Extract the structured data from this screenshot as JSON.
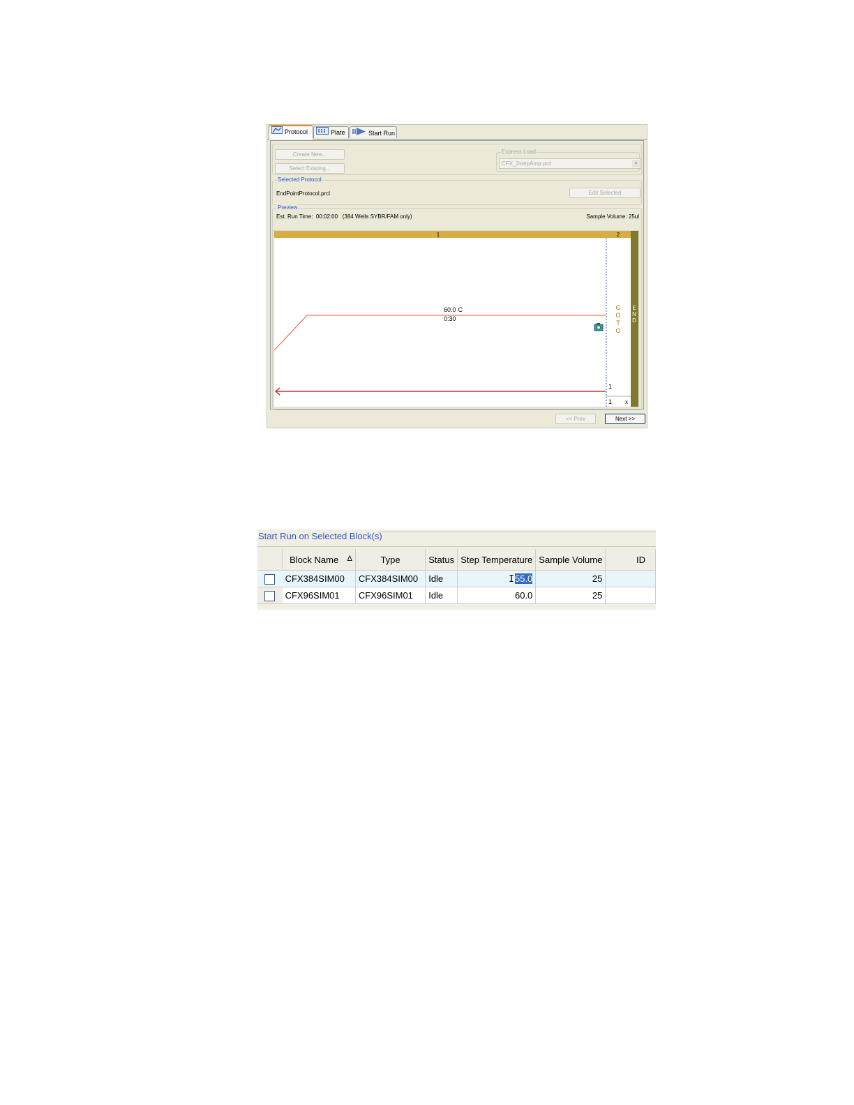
{
  "protocol_window": {
    "tabs": [
      {
        "label": "Protocol",
        "icon": "protocol-graph-icon",
        "active": true
      },
      {
        "label": "Plate",
        "icon": "plate-grid-icon",
        "active": false
      },
      {
        "label": "Start Run",
        "icon": "start-run-arrow-icon",
        "active": false
      }
    ],
    "buttons": {
      "create_new": "Create New...",
      "select_existing": "Select Existing...",
      "edit_selected": "Edit Selected"
    },
    "express_load": {
      "label": "Express Load",
      "value": "CFX_2stepAmp.prcl"
    },
    "selected_protocol": {
      "label": "Selected Protocol",
      "file": "EndPointProtocol.prcl"
    },
    "preview": {
      "label": "Preview",
      "est_run_time_label": "Est. Run Time:",
      "est_run_time_value": "00:02:00",
      "note": "(384 Wells SYBR/FAM only)",
      "sample_volume": "Sample Volume:  25ul"
    },
    "chart": {
      "step1_label": "1",
      "step2_label": "2",
      "temperature": "60.0",
      "unit": "C",
      "hold_time": "0:30",
      "goto_letters": [
        "G",
        "O",
        "T",
        "O"
      ],
      "end_letters": [
        "E",
        "N",
        "D"
      ],
      "goto_step": "1",
      "goto_cycles": "1",
      "cycles_suffix": "x"
    },
    "nav": {
      "prev": "<< Prev",
      "next": "Next >>"
    },
    "colors": {
      "step_band": "#d9ad45",
      "end_band": "#7d7a2b",
      "ramp_line": "#e8593f",
      "loop_arrow": "#c0392b",
      "goto_text": "#a27a1a"
    }
  },
  "block_table": {
    "title": "Start Run on Selected Block(s)",
    "columns": [
      "Block Name",
      "Type",
      "Status",
      "Step Temperature",
      "Sample Volume",
      "ID"
    ],
    "sort_indicator": "Δ",
    "rows": [
      {
        "block_name": "CFX384SIM00",
        "type": "CFX384SIM00",
        "status": "Idle",
        "step_temperature": "55.0",
        "sample_volume": "25",
        "id": "",
        "checked": false
      },
      {
        "block_name": "CFX96SIM01",
        "type": "CFX96SIM01",
        "status": "Idle",
        "step_temperature": "60.0",
        "sample_volume": "25",
        "id": "",
        "checked": false
      }
    ]
  }
}
